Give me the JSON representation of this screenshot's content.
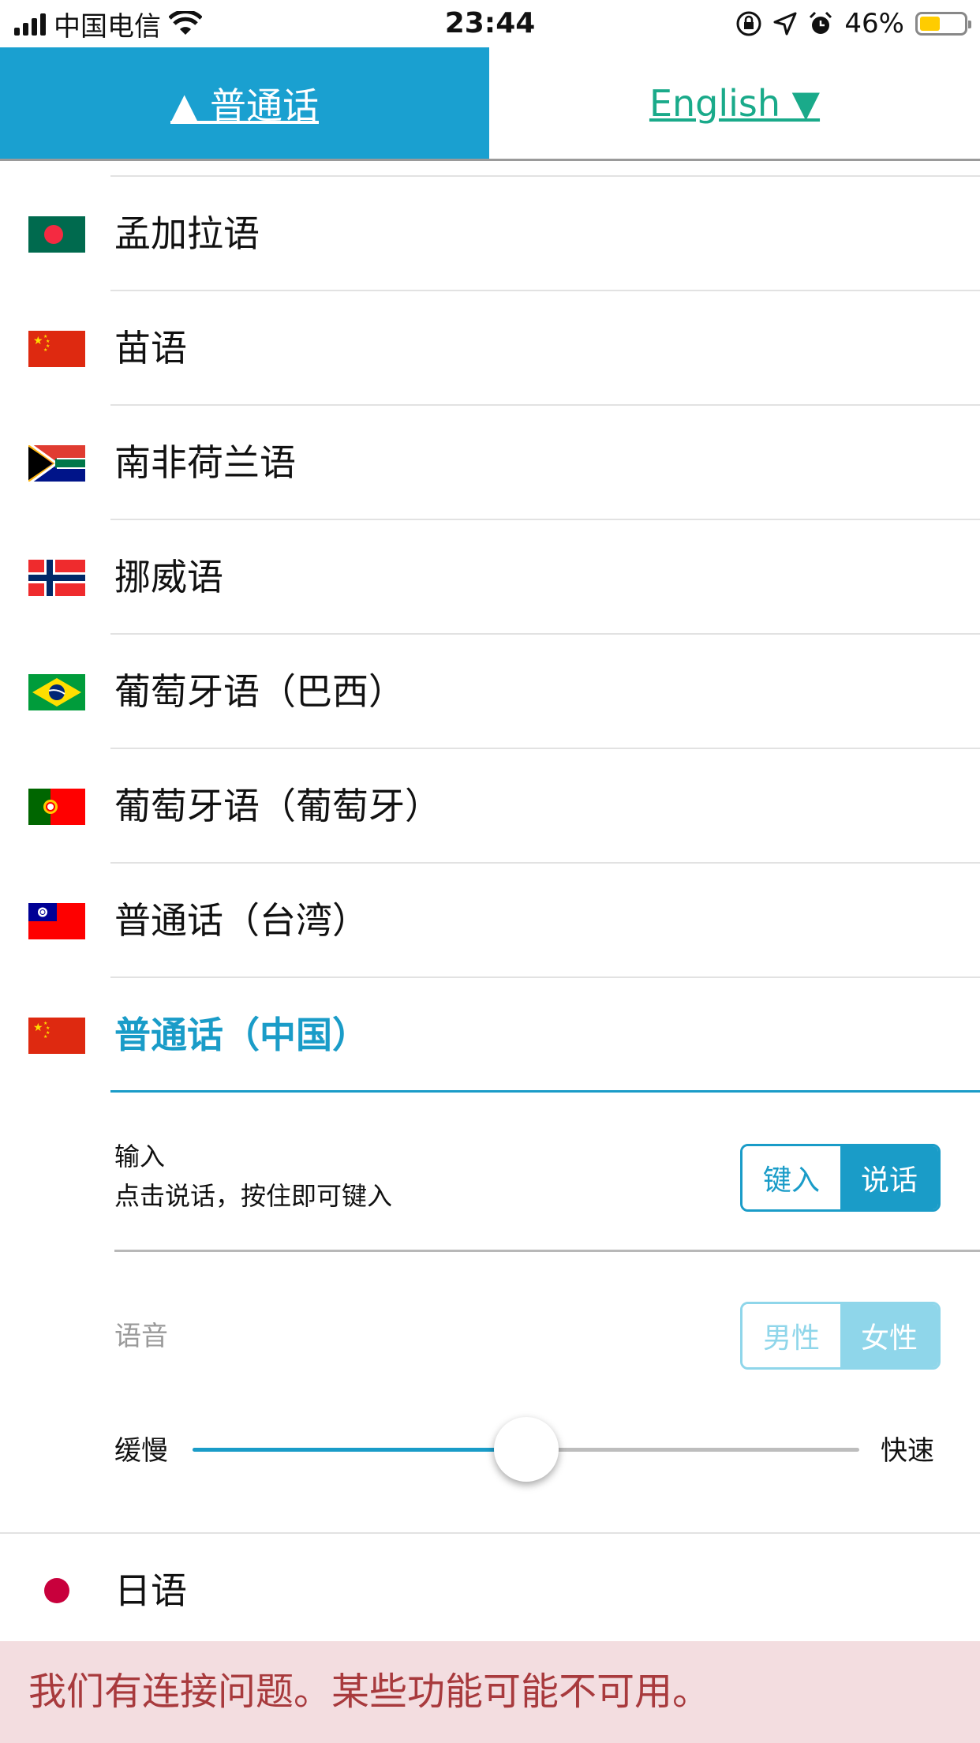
{
  "status_bar": {
    "carrier": "中国电信",
    "time": "23:44",
    "battery_percent": "46%",
    "battery_level": 0.46,
    "icons": [
      "signal-icon",
      "wifi-icon",
      "orientation-lock-icon",
      "location-icon",
      "alarm-icon",
      "battery-icon"
    ]
  },
  "tabs": {
    "source": "▲ 普通话",
    "target": "English ▼"
  },
  "languages": [
    {
      "label": "孟加拉语",
      "flag": "bangladesh-flag-icon"
    },
    {
      "label": "苗语",
      "flag": "china-flag-icon"
    },
    {
      "label": "南非荷兰语",
      "flag": "south-africa-flag-icon"
    },
    {
      "label": "挪威语",
      "flag": "norway-flag-icon"
    },
    {
      "label": "葡萄牙语（巴西）",
      "flag": "brazil-flag-icon"
    },
    {
      "label": "葡萄牙语（葡萄牙）",
      "flag": "portugal-flag-icon"
    },
    {
      "label": "普通话（台湾）",
      "flag": "taiwan-flag-icon"
    },
    {
      "label": "普通话（中国）",
      "flag": "china-flag-icon",
      "selected": true
    }
  ],
  "settings": {
    "input_title": "输入",
    "input_hint": "点击说话，按住即可键入",
    "input_options": [
      "键入",
      "说话"
    ],
    "input_selected": "说话",
    "voice_title": "语音",
    "voice_options": [
      "男性",
      "女性"
    ],
    "voice_selected": "女性",
    "speed_slow": "缓慢",
    "speed_fast": "快速",
    "speed_value": 0.5
  },
  "next_language": {
    "label": "日语",
    "flag": "japan-dot-icon"
  },
  "banner": {
    "message": "我们有连接问题。某些功能可能不可用。"
  },
  "colors": {
    "accent": "#1aa0d0",
    "target_tab_text": "#1aaa8a",
    "banner_bg": "#f3dde0",
    "banner_text": "#a83a3d"
  }
}
